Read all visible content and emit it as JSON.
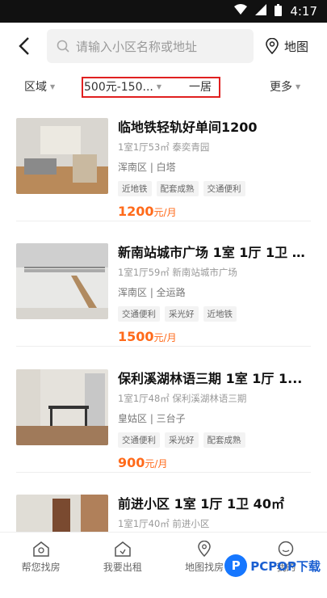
{
  "status": {
    "time": "4:17"
  },
  "header": {
    "search_placeholder": "请输入小区名称或地址",
    "map_label": "地图"
  },
  "filters": {
    "region": "区域",
    "price": "500元-150...",
    "rooms": "一居",
    "more": "更多"
  },
  "listings": [
    {
      "title": "临地铁轻轨好单间1200",
      "meta": "1室1厅53㎡  泰奕青园",
      "area": "浑南区 | 白塔",
      "tags": [
        "近地铁",
        "配套成熟",
        "交通便利"
      ],
      "price": "1200",
      "unit": "元/月"
    },
    {
      "title": "新南站城市广场 1室 1厅 1卫 5...",
      "meta": "1室1厅59㎡  新南站城市广场",
      "area": "浑南区 | 全运路",
      "tags": [
        "交通便利",
        "采光好",
        "近地铁"
      ],
      "price": "1500",
      "unit": "元/月"
    },
    {
      "title": "保利溪湖林语三期 1室 1厅 1...",
      "meta": "1室1厅48㎡  保利溪湖林语三期",
      "area": "皇姑区 | 三台子",
      "tags": [
        "交通便利",
        "采光好",
        "配套成熟"
      ],
      "price": "900",
      "unit": "元/月"
    },
    {
      "title": "前进小区 1室 1厅 1卫 40㎡",
      "meta": "1室1厅40㎡  前进小区",
      "area": "",
      "tags": [],
      "price": "",
      "unit": ""
    }
  ],
  "bottom_nav": [
    {
      "label": "帮您找房",
      "icon": "home-search-icon"
    },
    {
      "label": "我要出租",
      "icon": "rent-icon"
    },
    {
      "label": "地图找房",
      "icon": "map-pin-icon"
    },
    {
      "label": "我的",
      "icon": "user-icon"
    }
  ],
  "watermark": {
    "mark": "P",
    "text": "PCPOP下载"
  }
}
